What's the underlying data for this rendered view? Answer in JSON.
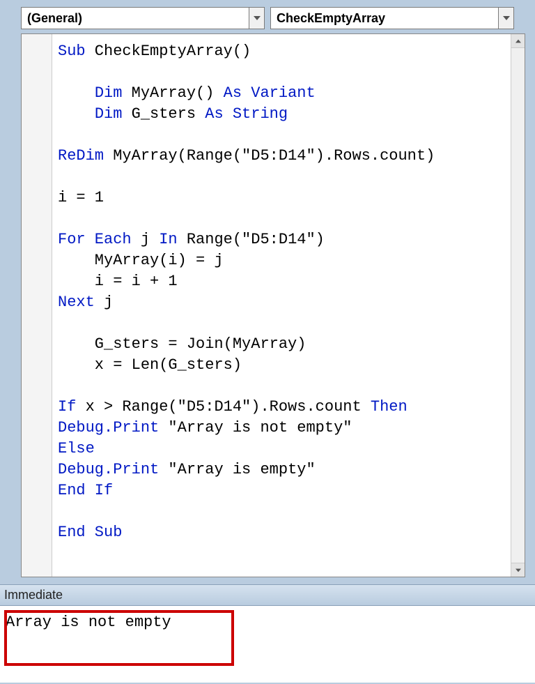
{
  "dropdowns": {
    "left": "(General)",
    "right": "CheckEmptyArray"
  },
  "code": {
    "tokens": [
      [
        {
          "t": "Sub",
          "k": true
        },
        {
          "t": " CheckEmptyArray()"
        }
      ],
      [],
      [
        {
          "t": "    "
        },
        {
          "t": "Dim",
          "k": true
        },
        {
          "t": " MyArray() "
        },
        {
          "t": "As Variant",
          "k": true
        }
      ],
      [
        {
          "t": "    "
        },
        {
          "t": "Dim",
          "k": true
        },
        {
          "t": " G_sters "
        },
        {
          "t": "As String",
          "k": true
        }
      ],
      [],
      [
        {
          "t": "ReDim",
          "k": true
        },
        {
          "t": " MyArray(Range(\"D5:D14\").Rows.count)"
        }
      ],
      [],
      [
        {
          "t": "i = 1"
        }
      ],
      [],
      [
        {
          "t": "For Each",
          "k": true
        },
        {
          "t": " j "
        },
        {
          "t": "In",
          "k": true
        },
        {
          "t": " Range(\"D5:D14\")"
        }
      ],
      [
        {
          "t": "    MyArray(i) = j"
        }
      ],
      [
        {
          "t": "    i = i + 1"
        }
      ],
      [
        {
          "t": "Next",
          "k": true
        },
        {
          "t": " j"
        }
      ],
      [],
      [
        {
          "t": "    G_sters = Join(MyArray)"
        }
      ],
      [
        {
          "t": "    x = Len(G_sters)"
        }
      ],
      [],
      [
        {
          "t": "If",
          "k": true
        },
        {
          "t": " x > Range(\"D5:D14\").Rows.count "
        },
        {
          "t": "Then",
          "k": true
        }
      ],
      [
        {
          "t": "Debug.Print",
          "k": true
        },
        {
          "t": " \"Array is not empty\""
        }
      ],
      [
        {
          "t": "Else",
          "k": true
        }
      ],
      [
        {
          "t": "Debug.Print",
          "k": true
        },
        {
          "t": " \"Array is empty\""
        }
      ],
      [
        {
          "t": "End If",
          "k": true
        }
      ],
      [],
      [
        {
          "t": "End Sub",
          "k": true
        }
      ]
    ]
  },
  "immediate": {
    "title": "Immediate",
    "output": "Array is not empty"
  }
}
